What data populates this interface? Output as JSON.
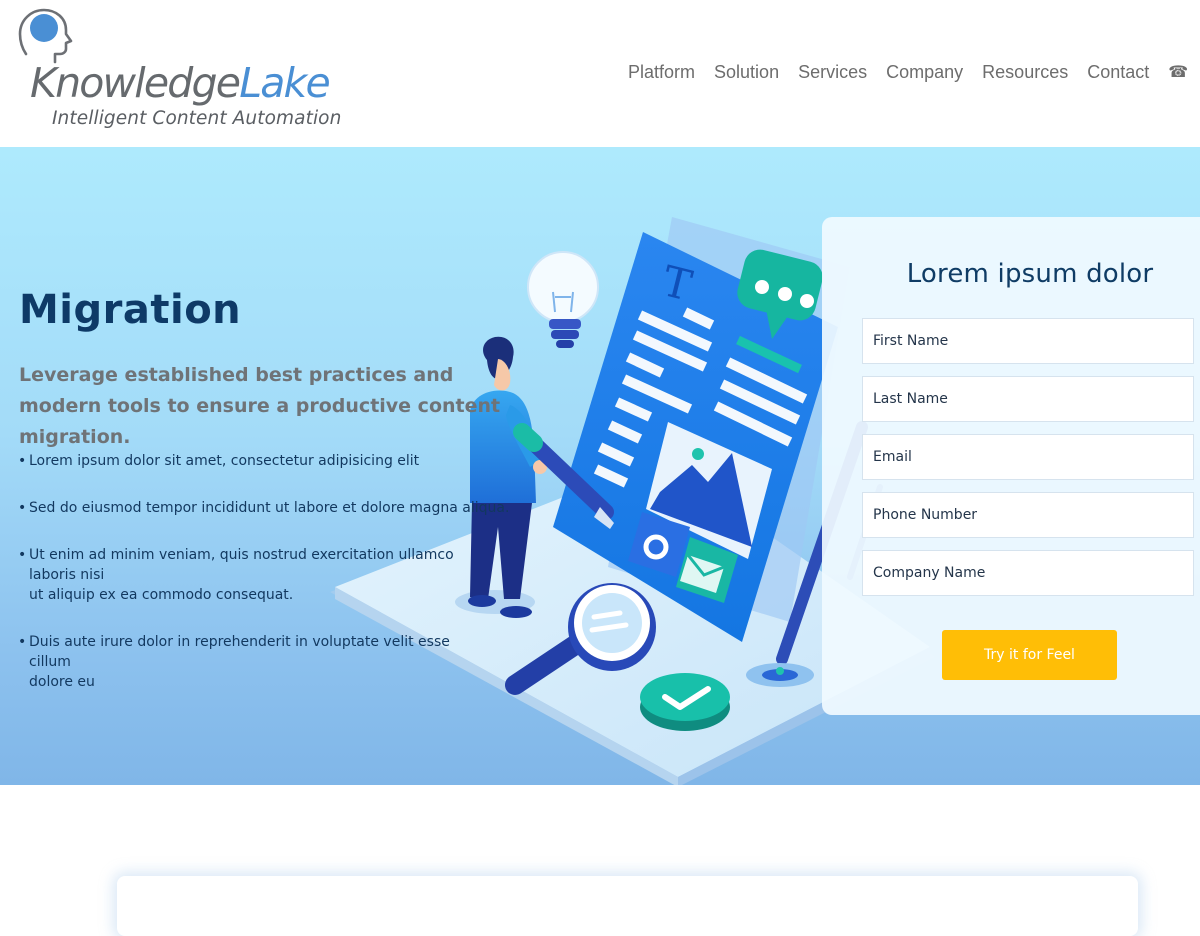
{
  "brand": {
    "name_part1": "Knowledge",
    "name_part2": "Lake",
    "tagline": "Intelligent Content Automation"
  },
  "nav": {
    "items": [
      "Platform",
      "Solution",
      "Services",
      "Company",
      "Resources",
      "Contact"
    ],
    "phone_icon": "phone-icon",
    "phone_glyph": "☎"
  },
  "hero": {
    "title": "Migration",
    "subtitle": "Leverage established best practices and modern tools to ensure a productive content migration.",
    "bullets": [
      "Lorem ipsum dolor sit amet, consectetur adipisicing elit",
      "Sed do eiusmod tempor incididunt ut labore et dolore magna aliqua.",
      "Ut enim ad minim veniam, quis nostrud exercitation ullamco laboris nisi\nut aliquip ex ea commodo consequat.",
      "Duis aute irure dolor in reprehenderit in voluptate velit esse cillum\ndolore eu"
    ]
  },
  "form": {
    "title": "Lorem ipsum dolor",
    "fields": {
      "first_name": "First Name",
      "last_name": "Last Name",
      "email": "Email",
      "phone": "Phone Number",
      "company": "Company Name"
    },
    "submit_label": "Try it for Feel"
  },
  "colors": {
    "brand_blue": "#4a8fd4",
    "title_navy": "#0e3a67",
    "cta_yellow": "#ffbe06",
    "hero_top": "#aeeafd",
    "hero_bottom": "#80b6e8"
  }
}
